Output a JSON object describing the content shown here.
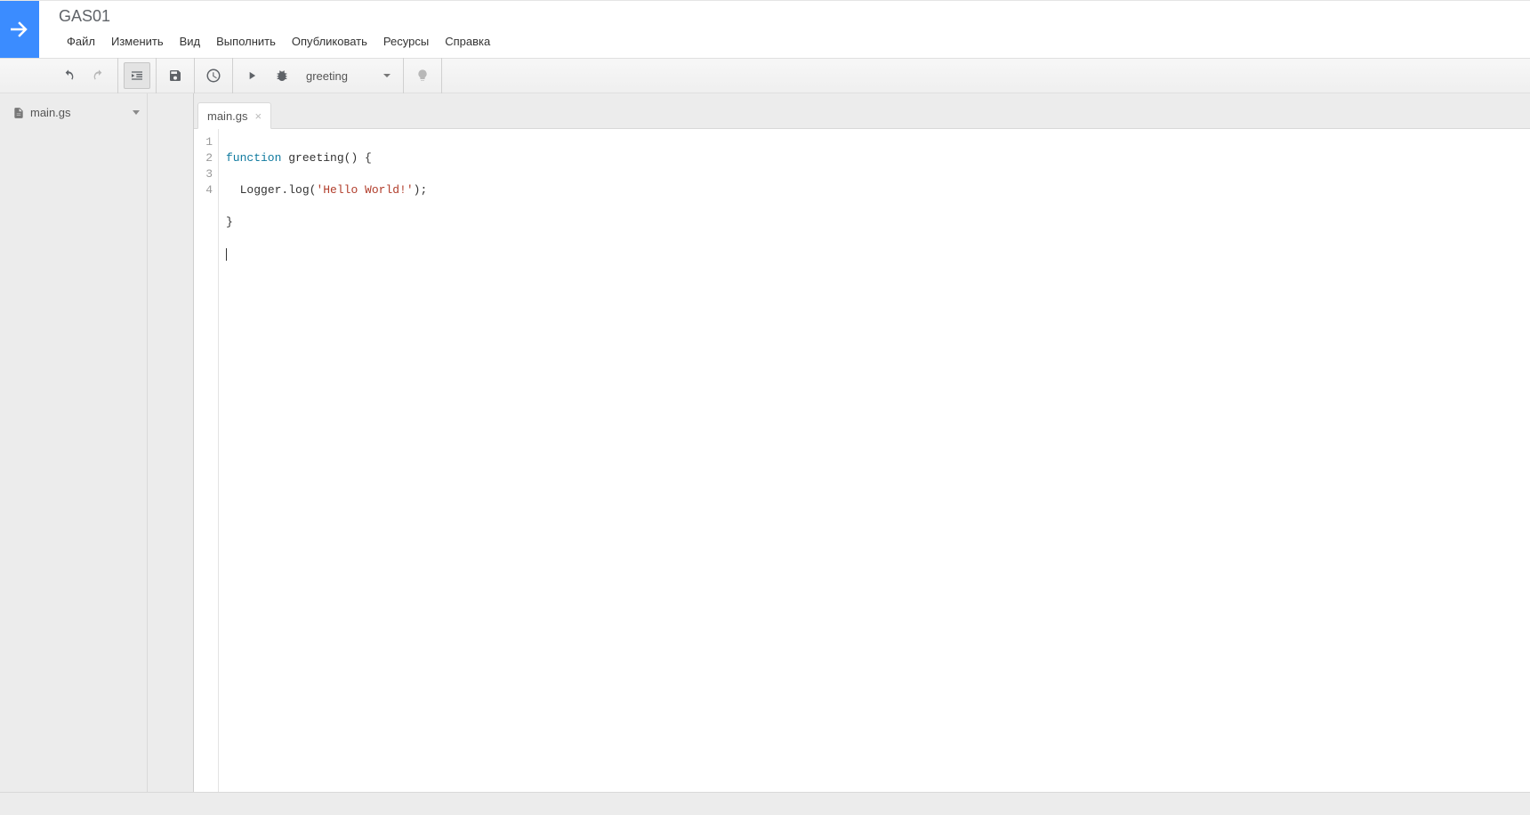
{
  "project": {
    "title": "GAS01"
  },
  "menubar": {
    "file": "Файл",
    "edit": "Изменить",
    "view": "Вид",
    "run": "Выполнить",
    "publish": "Опубликовать",
    "resources": "Ресурсы",
    "help": "Справка"
  },
  "toolbar": {
    "function_selected": "greeting"
  },
  "sidebar": {
    "files": [
      {
        "name": "main.gs"
      }
    ]
  },
  "tabs": [
    {
      "label": "main.gs"
    }
  ],
  "editor": {
    "line_numbers": [
      "1",
      "2",
      "3",
      "4"
    ],
    "code": {
      "l1": {
        "kw": "function",
        "sp": " ",
        "name": "greeting",
        "rest": "() {"
      },
      "l2": {
        "indent": "  ",
        "call": "Logger.log(",
        "str": "'Hello World!'",
        "rest": ");"
      },
      "l3": "}",
      "l4": ""
    }
  }
}
